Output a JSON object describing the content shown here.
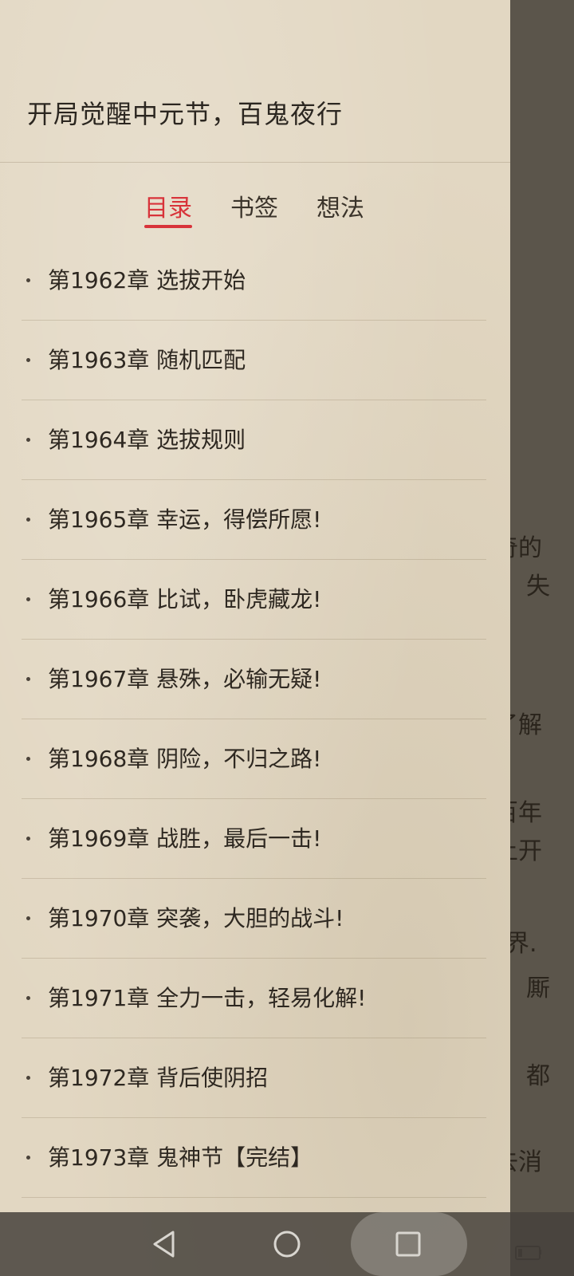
{
  "reader": {
    "lines": [
      {
        "text": "奇的"
      },
      {
        "text": "失"
      },
      {
        "text": "了解"
      },
      {
        "text": "百年"
      },
      {
        "text": "上开"
      },
      {
        "text": "界."
      },
      {
        "text": "厮"
      },
      {
        "text": "都"
      },
      {
        "text": "去消"
      }
    ]
  },
  "drawer": {
    "book_title": "开局觉醒中元节，百鬼夜行",
    "tabs": [
      {
        "label": "目录"
      },
      {
        "label": "书签"
      },
      {
        "label": "想法"
      }
    ],
    "active_tab": "目录",
    "toc": [
      {
        "label": "第1962章 选拔开始"
      },
      {
        "label": "第1963章 随机匹配"
      },
      {
        "label": "第1964章 选拔规则"
      },
      {
        "label": "第1965章 幸运，得偿所愿!"
      },
      {
        "label": "第1966章 比试，卧虎藏龙!"
      },
      {
        "label": "第1967章 悬殊，必输无疑!"
      },
      {
        "label": "第1968章 阴险，不归之路!"
      },
      {
        "label": "第1969章 战胜，最后一击!"
      },
      {
        "label": "第1970章 突袭，大胆的战斗!"
      },
      {
        "label": "第1971章 全力一击，轻易化解!"
      },
      {
        "label": "第1972章 背后使阴招"
      },
      {
        "label": "第1973章 鬼神节【完结】"
      }
    ]
  },
  "navbar": {
    "back_icon": "triangle-back-icon",
    "home_icon": "circle-home-icon",
    "recent_icon": "square-recent-icon"
  },
  "colors": {
    "accent": "#d8333a",
    "drawer_bg": "#e2d7c2",
    "text": "#2e2821"
  }
}
